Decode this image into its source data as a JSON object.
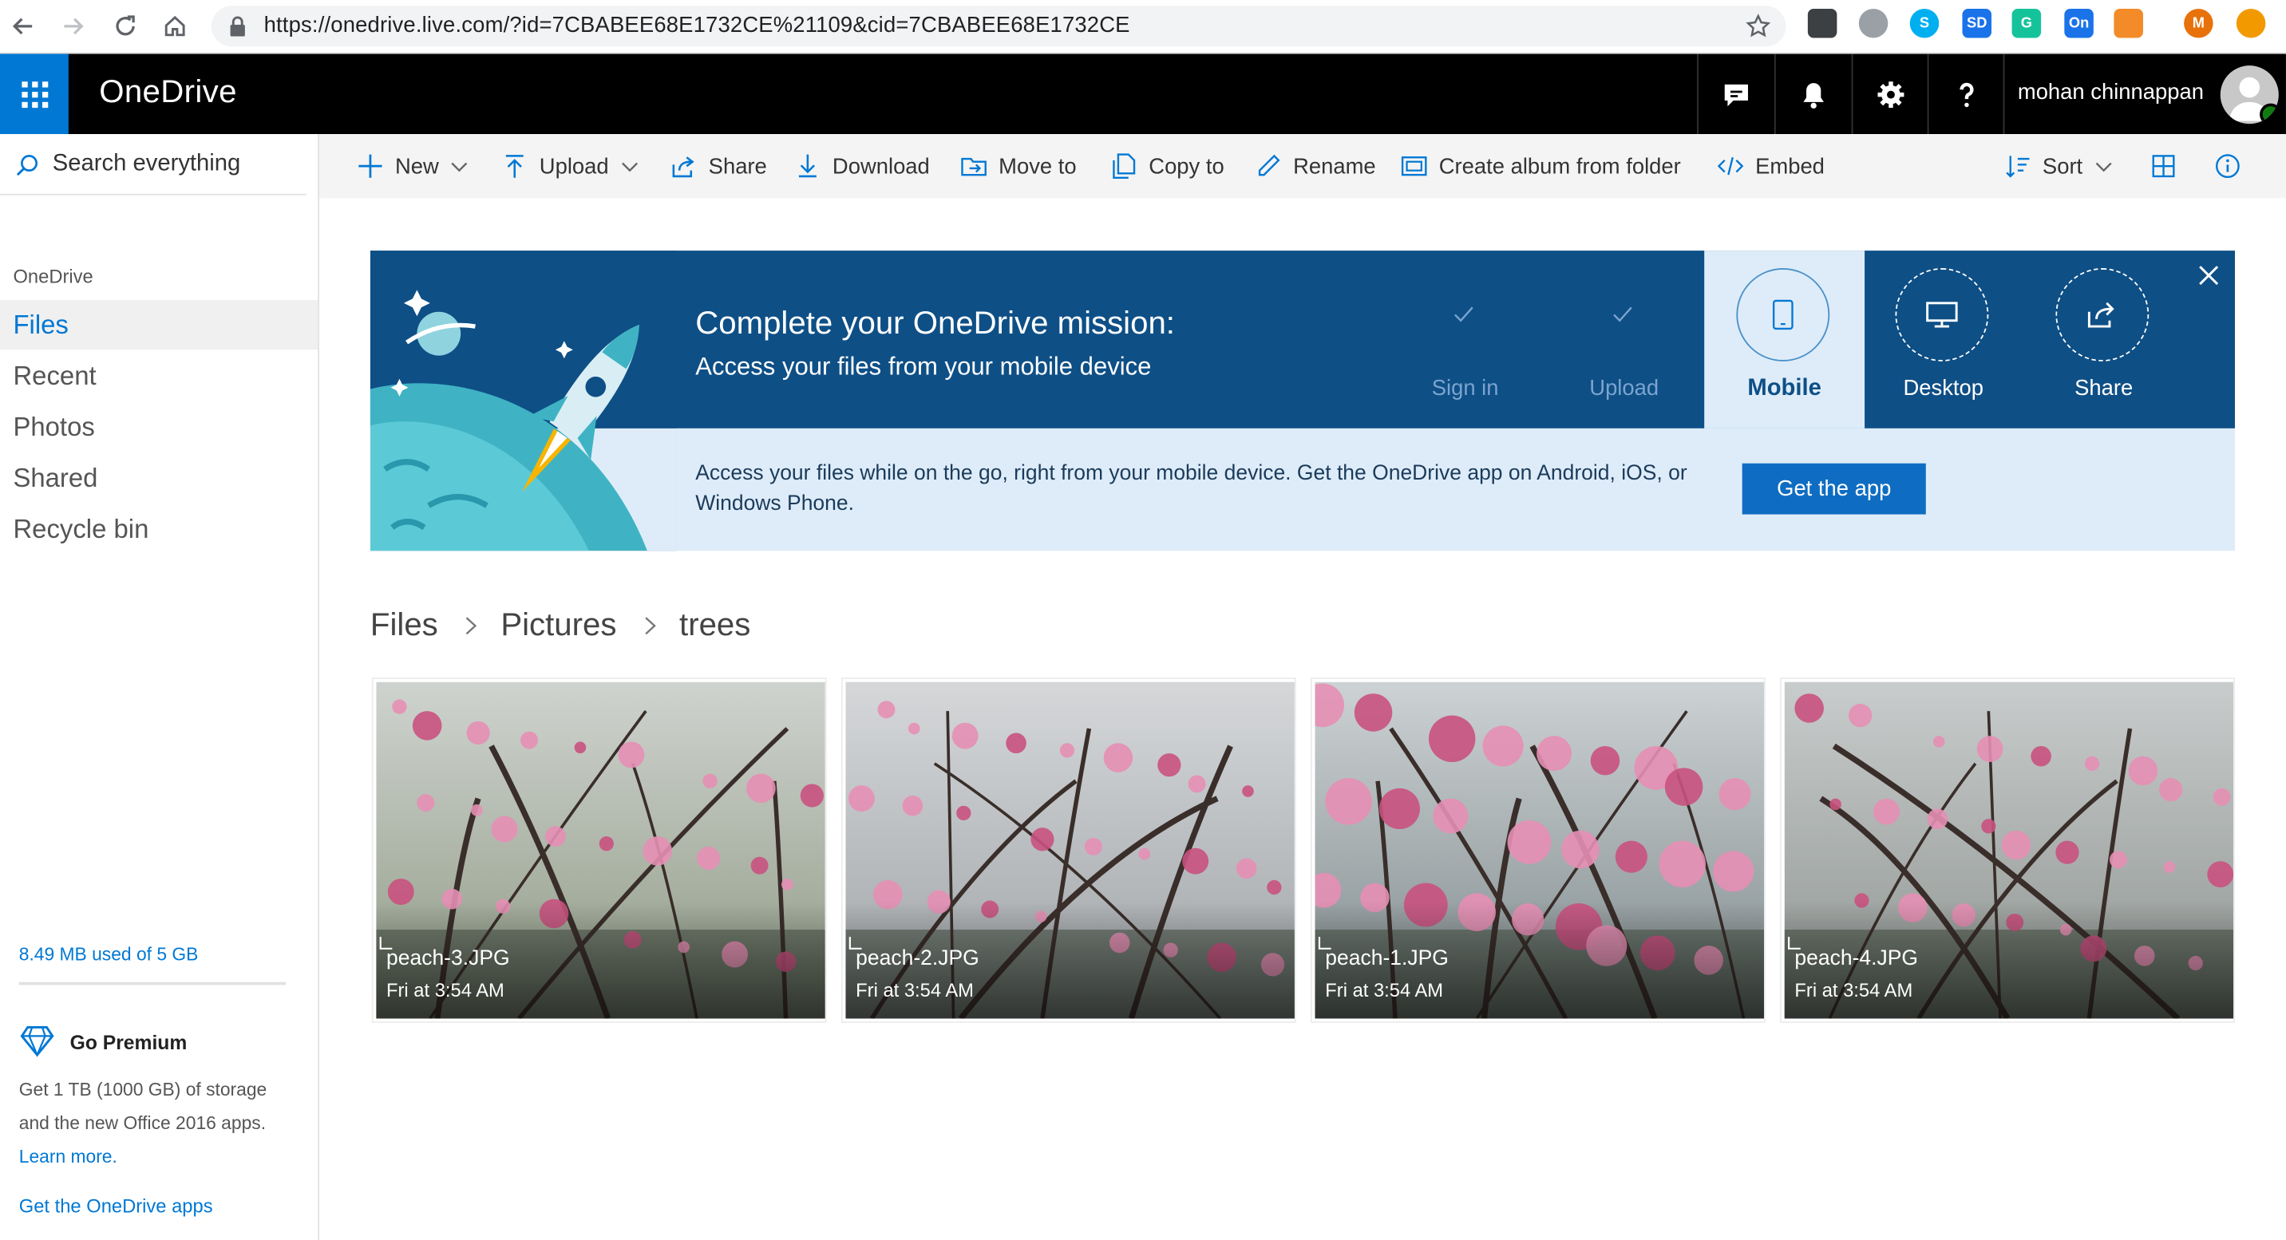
{
  "browser": {
    "url": "https://onedrive.live.com/?id=7CBABEE68E1732CE%21109&cid=7CBABEE68E1732CE",
    "extensions": [
      {
        "icon": "menu-dots-icon",
        "color": "#3c4043",
        "text": ""
      },
      {
        "icon": "circle-icon",
        "color": "#9aa0a6",
        "text": ""
      },
      {
        "icon": "skype-icon",
        "color": "#00aff0",
        "text": "S"
      },
      {
        "icon": "sd-icon",
        "color": "#1a73e8",
        "text": "SD"
      },
      {
        "icon": "grammarly-icon",
        "color": "#15c39a",
        "text": "G"
      },
      {
        "icon": "on-icon",
        "color": "#1a73e8",
        "text": "On"
      },
      {
        "icon": "orange-grid-icon",
        "color": "#f28b28",
        "text": ""
      },
      {
        "icon": "profile-m-icon",
        "color": "#e8710a",
        "text": "M"
      },
      {
        "icon": "update-icon",
        "color": "#f29900",
        "text": ""
      }
    ]
  },
  "suite": {
    "brand": "OneDrive",
    "user_name": "mohan chinnappan"
  },
  "sidebar": {
    "search_placeholder": "Search everything",
    "heading": "OneDrive",
    "items": [
      {
        "label": "Files",
        "active": true
      },
      {
        "label": "Recent",
        "active": false
      },
      {
        "label": "Photos",
        "active": false
      },
      {
        "label": "Shared",
        "active": false
      },
      {
        "label": "Recycle bin",
        "active": false
      }
    ],
    "quota": "8.49 MB used of 5 GB",
    "premium": {
      "title": "Go Premium",
      "desc": "Get 1 TB (1000 GB) of storage and the new Office 2016 apps.",
      "learn_more": "Learn more."
    },
    "get_apps": "Get the OneDrive apps"
  },
  "commands": {
    "new": "New",
    "upload": "Upload",
    "share": "Share",
    "download": "Download",
    "move_to": "Move to",
    "copy_to": "Copy to",
    "rename": "Rename",
    "create_album": "Create album from folder",
    "embed": "Embed",
    "sort": "Sort"
  },
  "banner": {
    "title": "Complete your OneDrive mission:",
    "subtitle": "Access your files from your mobile device",
    "steps": {
      "sign_in": "Sign in",
      "upload": "Upload",
      "mobile": "Mobile",
      "desktop": "Desktop",
      "share": "Share"
    },
    "body": "Access your files while on the go, right from your mobile device. Get the OneDrive app on Android, iOS, or Windows Phone.",
    "button": "Get the app"
  },
  "breadcrumb": [
    "Files",
    "Pictures",
    "trees"
  ],
  "files": [
    {
      "name": "peach-3.JPG",
      "date": "Fri at 3:54 AM"
    },
    {
      "name": "peach-2.JPG",
      "date": "Fri at 3:54 AM"
    },
    {
      "name": "peach-1.JPG",
      "date": "Fri at 3:54 AM"
    },
    {
      "name": "peach-4.JPG",
      "date": "Fri at 3:54 AM"
    }
  ],
  "colors": {
    "accent": "#0078d4",
    "banner_dark": "#0e4f86",
    "banner_light": "#deecf9",
    "blossom": "#e58fb4"
  }
}
